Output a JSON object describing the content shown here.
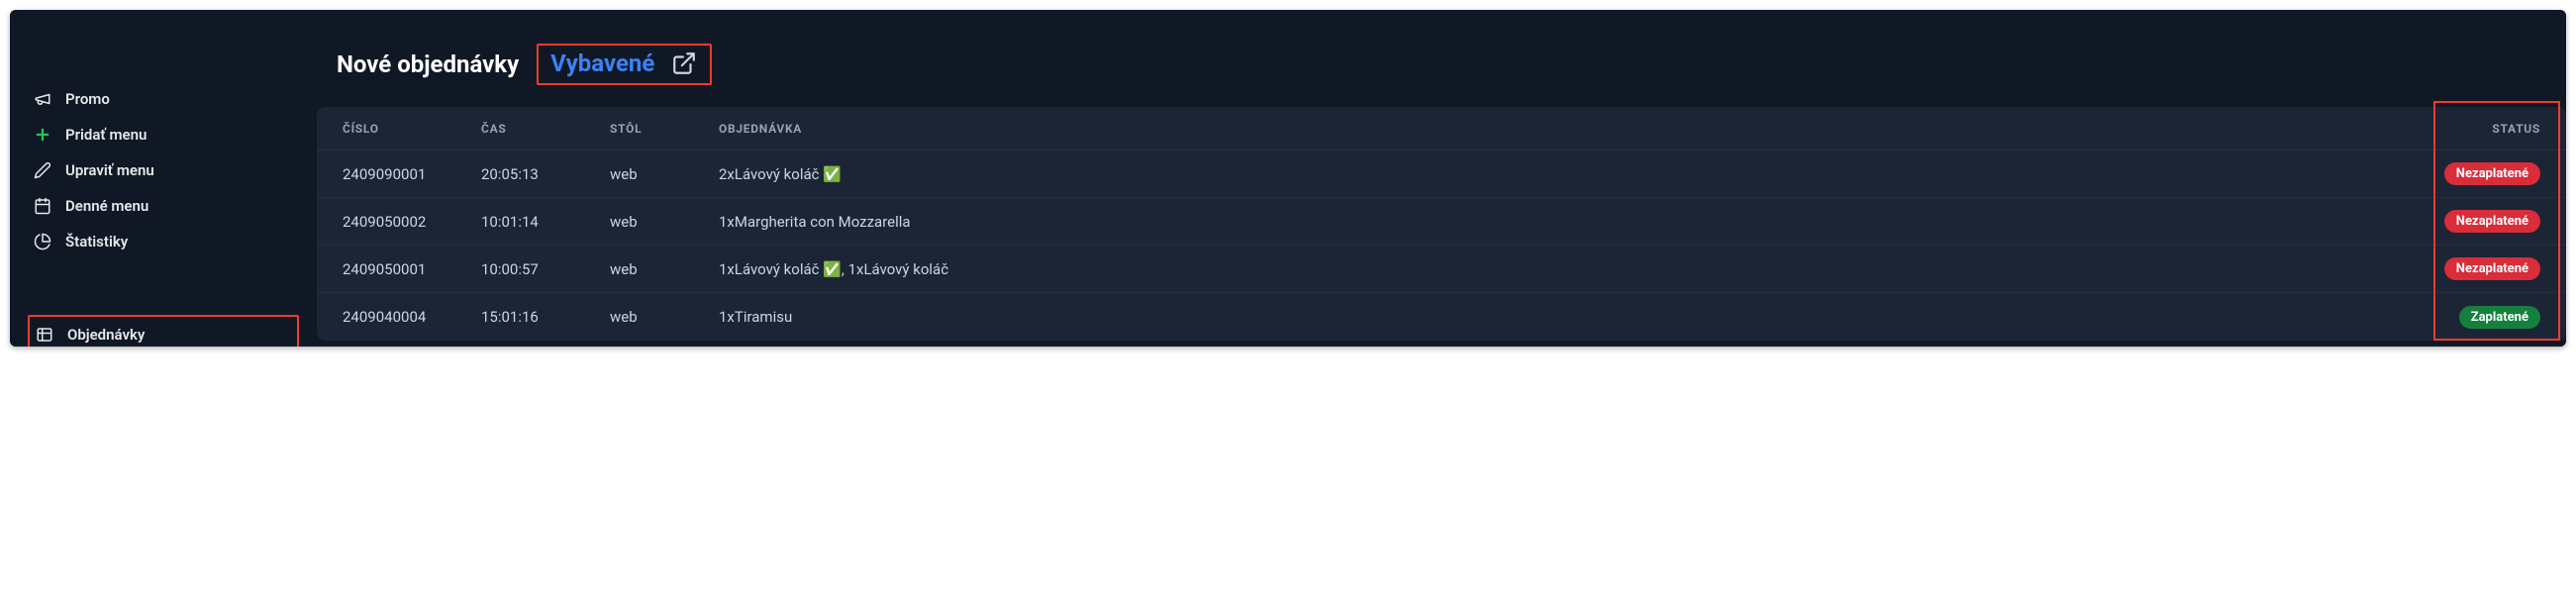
{
  "sidebar": {
    "items": [
      {
        "label": "Promo",
        "icon": "megaphone-icon"
      },
      {
        "label": "Pridať menu",
        "icon": "plus-icon"
      },
      {
        "label": "Upraviť menu",
        "icon": "pencil-icon"
      },
      {
        "label": "Denné menu",
        "icon": "calendar-icon"
      },
      {
        "label": "Štatistiky",
        "icon": "chart-icon"
      },
      {
        "label": "Objednávky",
        "icon": "orders-icon"
      }
    ]
  },
  "tabs": {
    "new_label": "Nové objednávky",
    "done_label": "Vybavené"
  },
  "table": {
    "headers": {
      "number": "ČÍSLO",
      "time": "ČAS",
      "table": "STÔL",
      "order": "OBJEDNÁVKA",
      "status": "STATUS"
    },
    "rows": [
      {
        "number": "2409090001",
        "time": "20:05:13",
        "table": "web",
        "order": "2xLávový koláč ✅",
        "status": "Nezaplatené",
        "status_kind": "red"
      },
      {
        "number": "2409050002",
        "time": "10:01:14",
        "table": "web",
        "order": "1xMargherita con Mozzarella",
        "status": "Nezaplatené",
        "status_kind": "red"
      },
      {
        "number": "2409050001",
        "time": "10:00:57",
        "table": "web",
        "order": "1xLávový koláč ✅, 1xLávový koláč",
        "status": "Nezaplatené",
        "status_kind": "red"
      },
      {
        "number": "2409040004",
        "time": "15:01:16",
        "table": "web",
        "order": "1xTiramisu",
        "status": "Zaplatené",
        "status_kind": "green"
      }
    ]
  }
}
